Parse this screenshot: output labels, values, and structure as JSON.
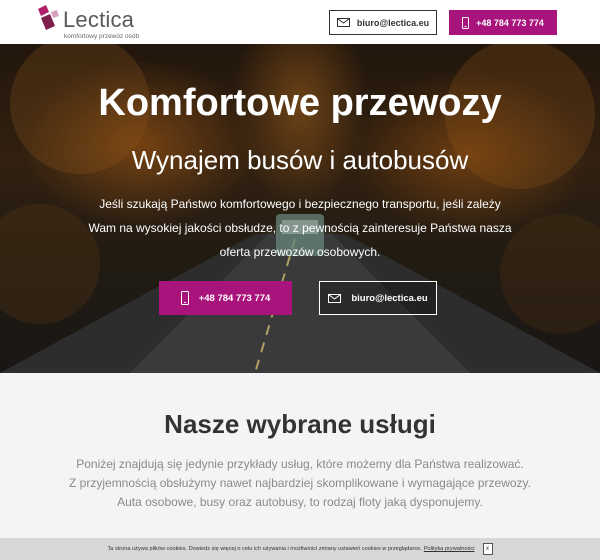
{
  "header": {
    "logo_name": "Lectica",
    "logo_tagline": "komfortowy przewóz osób",
    "email_label": "biuro@lectica.eu",
    "phone_label": "+48 784 773 774"
  },
  "hero": {
    "title": "Komfortowe przewozy",
    "subtitle": "Wynajem busów i autobusów",
    "description": "Jeśli szukają Państwo komfortowego i bezpiecznego transportu, jeśli zależy Wam na wysokiej jakości obsłudze, to z pewnością zainteresuje Państwa nasza oferta przewozów osobowych.",
    "phone_cta": "+48 784 773 774",
    "email_cta": "biuro@lectica.eu"
  },
  "services": {
    "title": "Nasze wybrane usługi",
    "line1": "Poniżej znajdują się jedynie przykłady usług, które możemy dla Państwa realizować.",
    "line2": "Z przyjemnością obsłużymy nawet najbardziej skomplikowane i wymagające przewozy.",
    "line3": "Auta osobowe, busy oraz autobusy, to rodzaj floty jaką dysponujemy."
  },
  "cookie": {
    "text": "Ta strona używa plików cookies. Dowiedz się więcej o celu ich używania i możliwości zmiany ustawień cookies w przeglądarce.",
    "link": "Polityka prywatności",
    "close": "x"
  },
  "colors": {
    "accent": "#a8137c",
    "services_bg": "#f4f4f5",
    "cookie_bg": "#d7d7d9"
  },
  "icons": [
    "logo-mark-icon",
    "envelope-icon",
    "phone-icon"
  ]
}
